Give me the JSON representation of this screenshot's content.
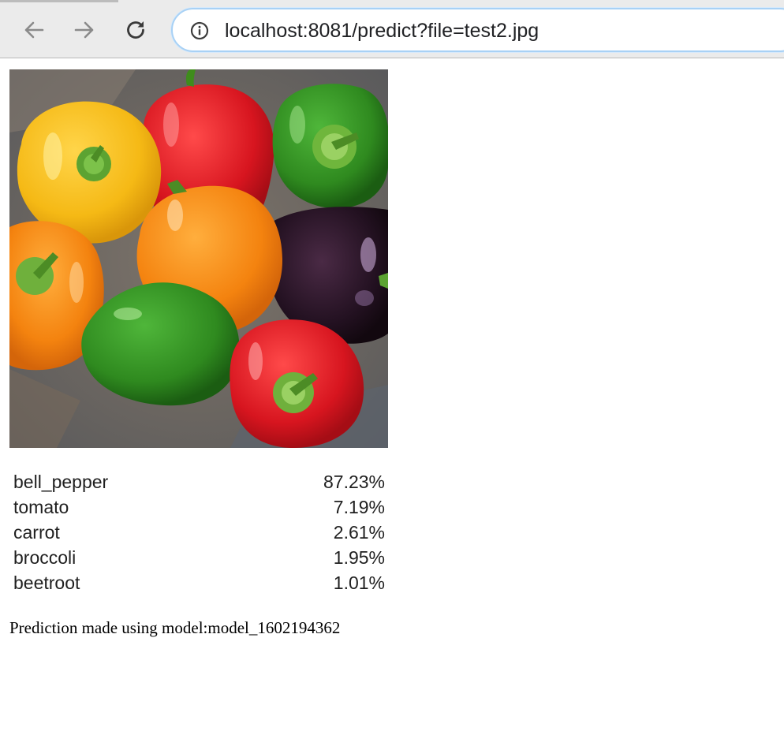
{
  "browser": {
    "url": "localhost:8081/predict?file=test2.jpg",
    "icons": {
      "back": "arrow-left-icon",
      "forward": "arrow-right-icon",
      "reload": "reload-icon",
      "site_info": "info-icon"
    }
  },
  "page": {
    "image": {
      "subject": "bell-peppers-photo",
      "colors": {
        "yellow": "#f5b915",
        "red": "#d7151f",
        "green": "#2f8a1f",
        "orange": "#f4830f",
        "purple": "#231121",
        "background": "#6b6662"
      }
    },
    "predictions": [
      {
        "label": "bell_pepper",
        "value": "87.23%"
      },
      {
        "label": "tomato",
        "value": "7.19%"
      },
      {
        "label": "carrot",
        "value": "2.61%"
      },
      {
        "label": "broccoli",
        "value": "1.95%"
      },
      {
        "label": "beetroot",
        "value": "1.01%"
      }
    ],
    "footer": "Prediction made using model:model_1602194362"
  }
}
